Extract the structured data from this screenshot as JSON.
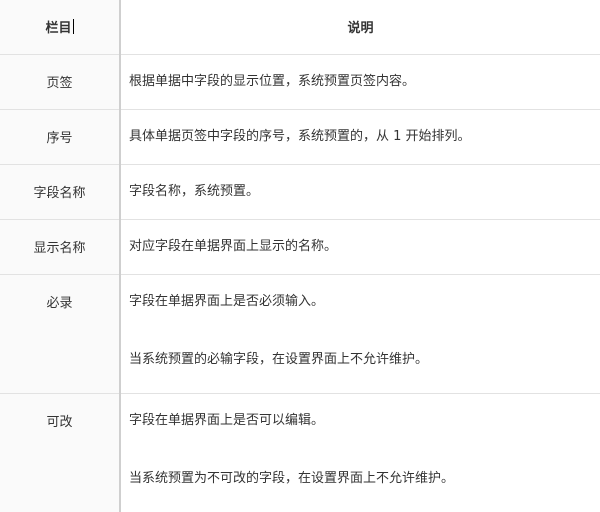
{
  "header": {
    "col_field": "栏目",
    "col_desc": "说明"
  },
  "rows": [
    {
      "name": "页签",
      "desc": [
        "根据单据中字段的显示位置，系统预置页签内容。"
      ]
    },
    {
      "name": "序号",
      "desc": [
        "具体单据页签中字段的序号，系统预置的，从 1 开始排列。"
      ]
    },
    {
      "name": "字段名称",
      "desc": [
        "字段名称，系统预置。"
      ]
    },
    {
      "name": "显示名称",
      "desc": [
        "对应字段在单据界面上显示的名称。"
      ]
    },
    {
      "name": "必录",
      "desc": [
        "字段在单据界面上是否必须输入。",
        "当系统预置的必输字段，在设置界面上不允许维护。"
      ]
    },
    {
      "name": "可改",
      "desc": [
        "字段在单据界面上是否可以编辑。",
        "当系统预置为不可改的字段，在设置界面上不允许维护。"
      ]
    }
  ]
}
